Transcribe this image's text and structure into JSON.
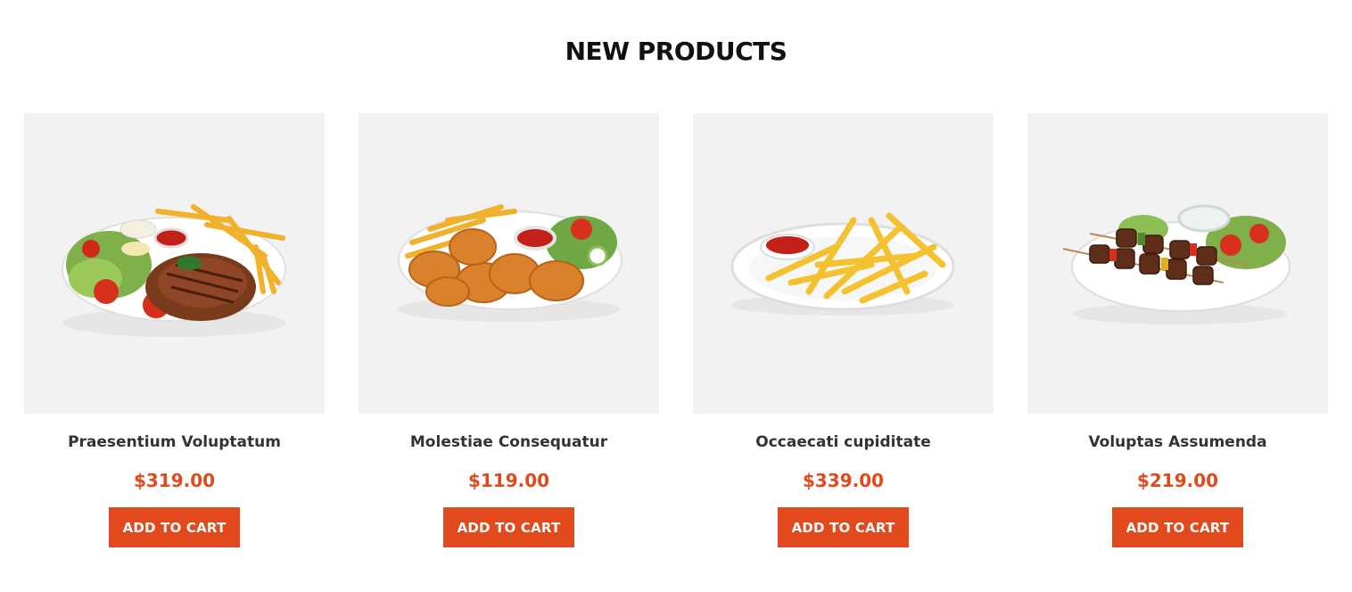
{
  "section": {
    "title": "NEW PRODUCTS"
  },
  "products": [
    {
      "name": "Praesentium Voluptatum",
      "price": "$319.00",
      "button_label": "ADD TO CART",
      "image_icon": "steak-fries-plate-icon"
    },
    {
      "name": "Molestiae Consequatur",
      "price": "$119.00",
      "button_label": "ADD TO CART",
      "image_icon": "chicken-nuggets-plate-icon"
    },
    {
      "name": "Occaecati cupiditate",
      "price": "$339.00",
      "button_label": "ADD TO CART",
      "image_icon": "french-fries-plate-icon"
    },
    {
      "name": "Voluptas Assumenda",
      "price": "$219.00",
      "button_label": "ADD TO CART",
      "image_icon": "kebab-skewer-plate-icon"
    }
  ],
  "colors": {
    "accent": "#e2491c",
    "image_background": "#f2f2f2",
    "title_text": "#111111",
    "name_text": "#333333"
  }
}
